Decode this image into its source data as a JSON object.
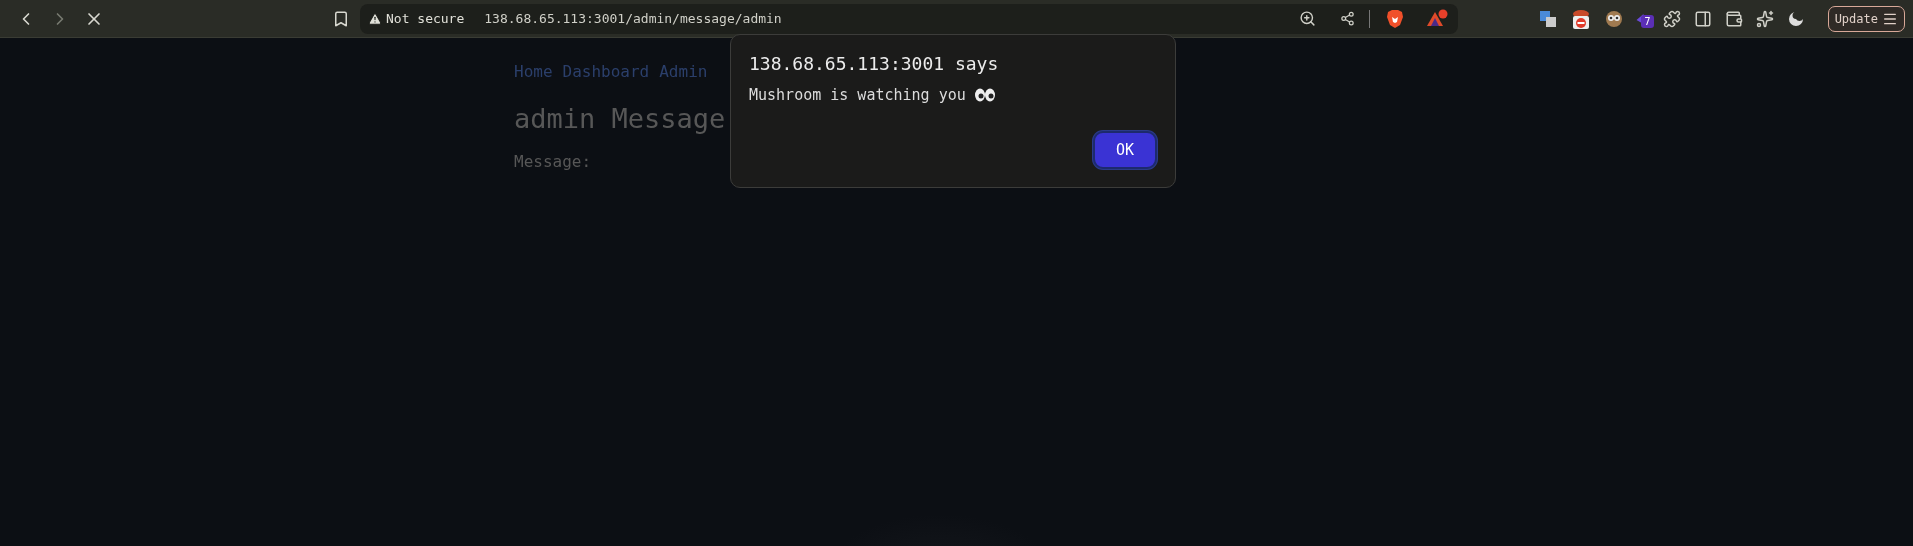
{
  "toolbar": {
    "security_label": "Not secure",
    "url": "138.68.65.113:3001/admin/message/admin",
    "extension_badge": "7",
    "update_button": "Update"
  },
  "page": {
    "nav_links": [
      "Home",
      "Dashboard",
      "Admin"
    ],
    "heading": "admin Message",
    "field_label": "Message:"
  },
  "dialog": {
    "title": "138.68.65.113:3001 says",
    "message": "Mushroom is watching you",
    "ok_button": "OK"
  }
}
